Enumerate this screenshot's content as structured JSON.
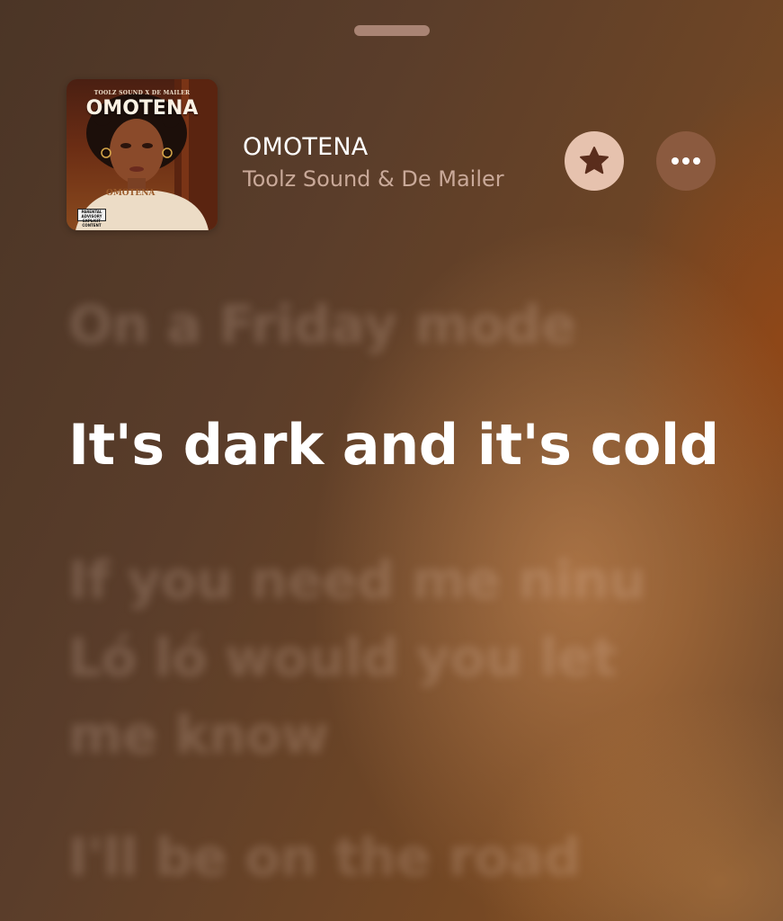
{
  "track": {
    "title": "OMOTENA",
    "artist": "Toolz Sound & De Mailer"
  },
  "artwork": {
    "top_credit": "TOOLZ SOUND X DE MAILER",
    "title": "OMOTENA",
    "shirt_text": "OMOTENA",
    "advisory": "PARENTAL ADVISORY EXPLICIT CONTENT"
  },
  "controls": {
    "favorite_icon": "star-icon",
    "more_icon": "ellipsis-icon"
  },
  "lyrics": {
    "previous": "On a Friday mode",
    "current": "It's dark and it's cold",
    "next": "If you need me ninu Ló ló would you let me know",
    "upcoming": "I'll be on the road"
  },
  "colors": {
    "accent_star_bg": "#e6c2ae",
    "more_bg": "#8b5a3f",
    "artist_text": "#c9a999"
  }
}
